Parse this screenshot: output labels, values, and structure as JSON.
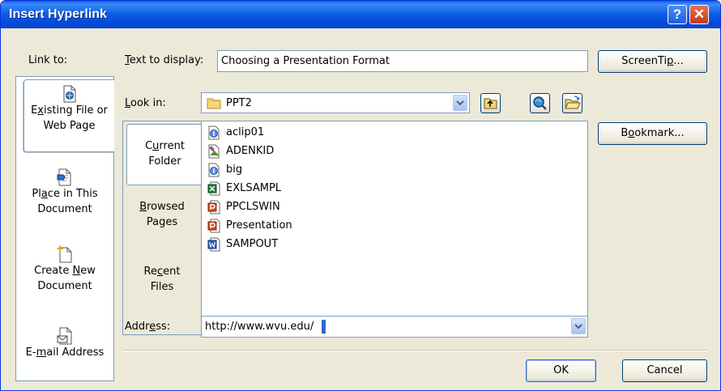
{
  "window": {
    "title": "Insert Hyperlink",
    "help": "?",
    "close": "✕"
  },
  "link_to": {
    "label": "Link to:",
    "items": [
      {
        "pre": "E",
        "acc": "x",
        "post": "isting File or",
        "line2": "Web Page"
      },
      {
        "pre": "Pl",
        "acc": "a",
        "post": "ce in This",
        "line2": "Document"
      },
      {
        "pre": "Create ",
        "acc": "N",
        "post": "ew",
        "line2": "Document"
      },
      {
        "pre": "E-",
        "acc": "m",
        "post": "ail Address",
        "line2": ""
      }
    ]
  },
  "text_to_display": {
    "pre": "",
    "acc": "T",
    "post": "ext to display:",
    "value": "Choosing a Presentation Format"
  },
  "screentip": {
    "pre": "ScreenTi",
    "acc": "p",
    "post": "..."
  },
  "look_in": {
    "pre": "",
    "acc": "L",
    "post": "ook in:",
    "value": "PPT2"
  },
  "bookmark": {
    "pre": "B",
    "acc": "o",
    "post": "okmark..."
  },
  "folder_tabs": [
    {
      "pre": "C",
      "acc": "u",
      "post": "rrent",
      "line2": "Folder"
    },
    {
      "pre": "",
      "acc": "B",
      "post": "rowsed",
      "line2": "Pages"
    },
    {
      "pre": "Re",
      "acc": "c",
      "post": "ent",
      "line2": "Files"
    }
  ],
  "files": [
    {
      "name": "aclip01",
      "icon": "info-file-icon"
    },
    {
      "name": "ADENKID",
      "icon": "image-file-icon"
    },
    {
      "name": "big",
      "icon": "info-file-icon"
    },
    {
      "name": "EXLSAMPL",
      "icon": "excel-file-icon"
    },
    {
      "name": "PPCLSWIN",
      "icon": "powerpoint-file-icon"
    },
    {
      "name": "Presentation",
      "icon": "powerpoint-file-icon"
    },
    {
      "name": "SAMPOUT",
      "icon": "word-file-icon"
    }
  ],
  "address": {
    "pre": "Addr",
    "acc": "e",
    "post": "ss:",
    "value": "http://www.wvu.edu/"
  },
  "buttons": {
    "ok": "OK",
    "cancel": "Cancel"
  }
}
